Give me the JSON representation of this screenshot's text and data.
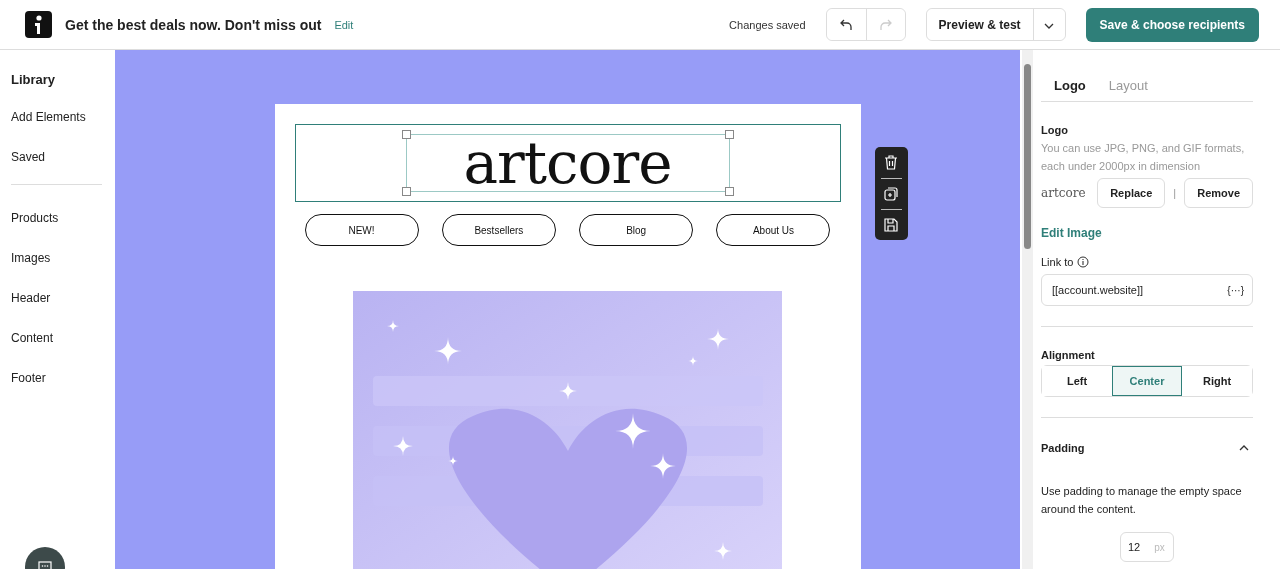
{
  "header": {
    "title": "Get the best deals now. Don't miss out",
    "edit_link": "Edit",
    "status": "Changes saved",
    "undo": {
      "disabled": false
    },
    "redo": {
      "disabled": true
    },
    "preview_button": "Preview & test",
    "save_button": "Save & choose recipients"
  },
  "sidebar": {
    "title": "Library",
    "groups": [
      [
        "Add Elements",
        "Saved"
      ],
      [
        "Products",
        "Images",
        "Header",
        "Content",
        "Footer"
      ]
    ]
  },
  "email": {
    "logo": "artcore",
    "logo_selected": true,
    "nav": [
      "NEW!",
      "Bestsellers",
      "Blog",
      "About Us"
    ],
    "banner": {
      "kind": "picture"
    }
  },
  "panel": {
    "tabs": [
      {
        "label": "Logo",
        "selected": true
      },
      {
        "label": "Layout",
        "selected": false
      }
    ],
    "logo_label": "Logo",
    "logo_hint": "You can use JPG, PNG, and GIF formats, each under 2000px in dimension",
    "logo_preview": "artcore",
    "replace_button": "Replace",
    "separator": "|",
    "remove_button": "Remove",
    "edit_image_link": "Edit Image",
    "link_label": "Link to",
    "link_value": "[[account.website]]",
    "link_token": "{···}",
    "alignment_label": "Alignment",
    "alignment": [
      {
        "label": "Left",
        "selected": false
      },
      {
        "label": "Center",
        "selected": true
      },
      {
        "label": "Right",
        "selected": false
      }
    ],
    "padding": {
      "title": "Padding",
      "expanded": true,
      "hint": "Use padding to manage the empty space around the content.",
      "value": "12",
      "unit": "px"
    }
  }
}
